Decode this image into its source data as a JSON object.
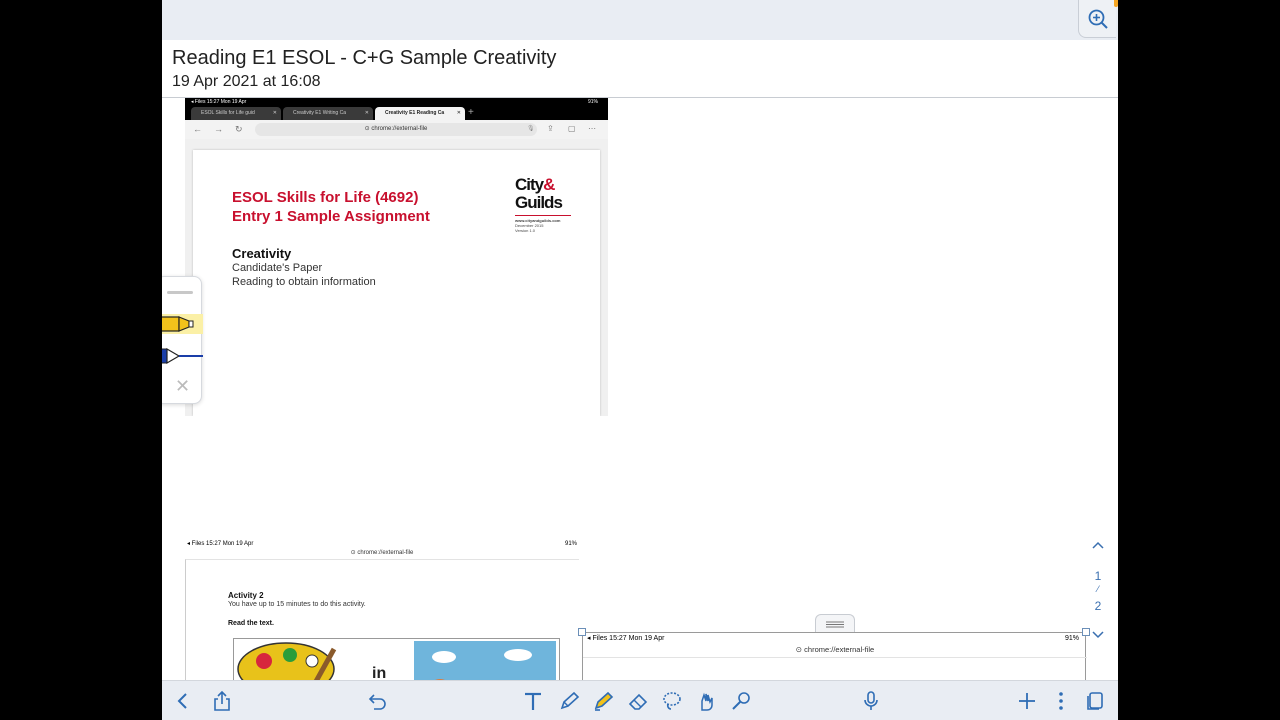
{
  "note": {
    "title": "Reading E1 ESOL - C+G Sample Creativity",
    "date": "19 Apr 2021 at 16:08"
  },
  "screenshot1": {
    "status_left": "◂ Files   15:27   Mon 19 Apr",
    "status_right": "91%",
    "tabs": [
      {
        "label": "ESOL Skills for Life guid"
      },
      {
        "label": "Creativity E1 Writing Ca"
      },
      {
        "label": "Creativity E1 Reading Ca"
      }
    ],
    "url": "⊙ chrome://external-file",
    "pdf": {
      "heading_line1": "ESOL Skills for Life (4692)",
      "heading_line2": "Entry 1 Sample Assignment",
      "subject": "Creativity",
      "line1": "Candidate's Paper",
      "line2": "Reading to obtain information",
      "logo": {
        "brand_city": "City",
        "brand_amp": "&",
        "brand_guilds": "Guilds",
        "website": "www.cityandguilds.com",
        "date": "December 2015",
        "version": "Version 1.0"
      }
    }
  },
  "screenshot2": {
    "status_left": "◂ Files   15:27   Mon 19 Apr",
    "status_right": "91%",
    "url": "⊙ chrome://external-file",
    "activity": "Activity 2",
    "instruction": "You have up to 15 minutes to do this activity.",
    "read": "Read the text.",
    "picture_text": "in"
  },
  "screenshot3": {
    "status_left": "◂ Files   15:27   Mon 19 Apr",
    "status_right": "91%",
    "url": "⊙ chrome://external-file"
  },
  "pager": {
    "current": "1",
    "separator": "⁄",
    "total": "2"
  },
  "colors": {
    "accent": "#3a6fb0",
    "brand_red": "#c8102e",
    "highlighter_yellow": "#f2c21b",
    "pen_blue": "#1a3ea8"
  }
}
